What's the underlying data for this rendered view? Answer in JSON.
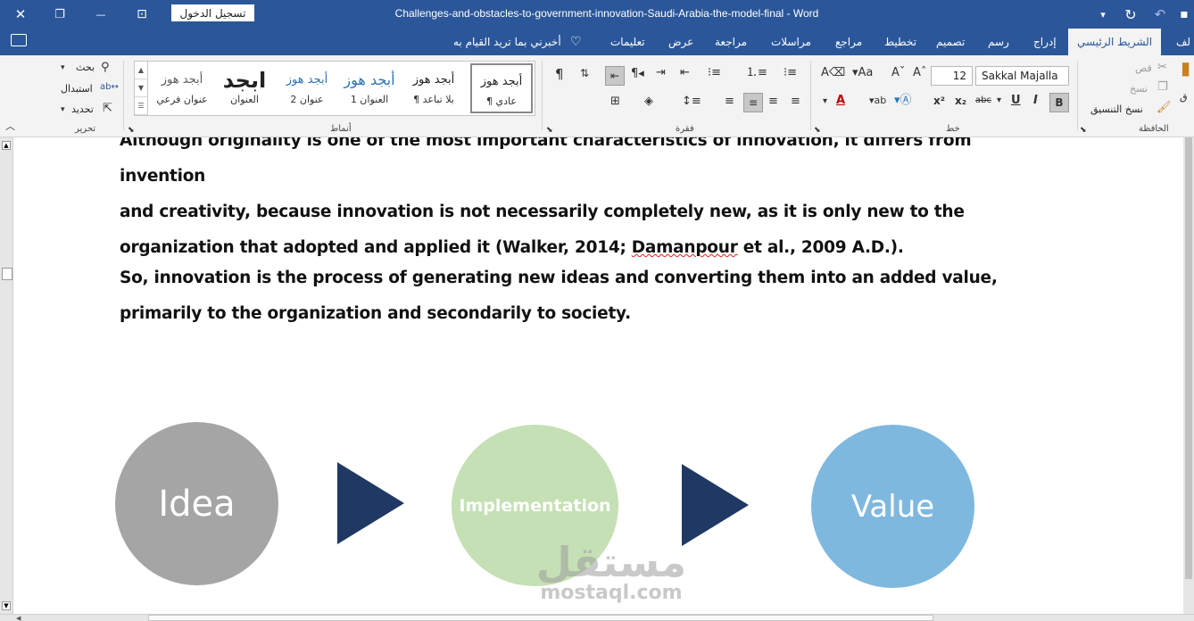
{
  "window": {
    "title": "Challenges-and-obstacles-to-government-innovation-Saudi-Arabia-the-model-final  -  Word",
    "signin_label": "تسجيل الدخول",
    "close_glyph": "✕",
    "restore_glyph": "❐",
    "minimize_glyph": "—",
    "ribbon_display_glyph": "⊡",
    "customize_qat_glyph": "▾",
    "redo_glyph": "↻",
    "undo_glyph": "↶",
    "save_glyph": "▪"
  },
  "tabs": {
    "file": "لف",
    "home": "الشريط الرئيسي",
    "insert": "إدراج",
    "draw": "رسم",
    "design": "تصميم",
    "layout": "تخطيط",
    "references": "مراجع",
    "mailings": "مراسلات",
    "review": "مراجعة",
    "view": "عرض",
    "help": "تعليمات",
    "tell_me": "أخبرني بما تريد القيام به"
  },
  "ribbon": {
    "editing": {
      "label": "تحرير",
      "find": "بحث",
      "replace": "استبدال",
      "select": "تحديد"
    },
    "styles": {
      "label": "أنماط",
      "items": [
        {
          "sample": "أبجد هوز",
          "name": "¶ عادي"
        },
        {
          "sample": "أبجد هوز",
          "name": "¶ بلا تباعد"
        },
        {
          "sample": "أبجد هوز",
          "name": "العنوان 1"
        },
        {
          "sample": "أبجد هوز",
          "name": "عنوان 2"
        },
        {
          "sample": "ابجد",
          "name": "العنوان"
        },
        {
          "sample": "أبجد هوز",
          "name": "عنوان فرعي"
        }
      ]
    },
    "paragraph": {
      "label": "فقرة"
    },
    "font": {
      "label": "خط",
      "font_name": "Sakkal Majalla",
      "font_size": "12"
    },
    "clipboard": {
      "label": "الحافظة",
      "cut": "قص",
      "copy": "نسخ",
      "format_painter": "نسخ التنسيق",
      "paste": "ق"
    }
  },
  "document": {
    "para1_line1": "Although originality is one of the most important characteristics of innovation, it differs from invention",
    "para1_line2": "and creativity, because innovation is not necessarily completely new, as it is only new to the",
    "para1_line3_a": "organization that adopted and applied it (Walker, 2014; ",
    "para1_line3_b": "Damanpour",
    "para1_line3_c": " et al., 2009 A.D.).",
    "para2_line1": "So, innovation is the process of generating new ideas and converting them into an added value,",
    "para2_line2": "primarily to the organization and secondarily to society."
  },
  "diagram": {
    "nodes": [
      {
        "label": "Idea",
        "color": "#a5a5a5"
      },
      {
        "label": "Implementation",
        "color": "#c5e0b4"
      },
      {
        "label": "Value",
        "color": "#7fb8df"
      }
    ],
    "arrow_color": "#1f3864"
  },
  "watermark": {
    "arabic": "مستقل",
    "latin": "mostaql.com"
  },
  "colors": {
    "word_blue": "#2b579a",
    "ribbon_bg": "#f3f3f3"
  }
}
